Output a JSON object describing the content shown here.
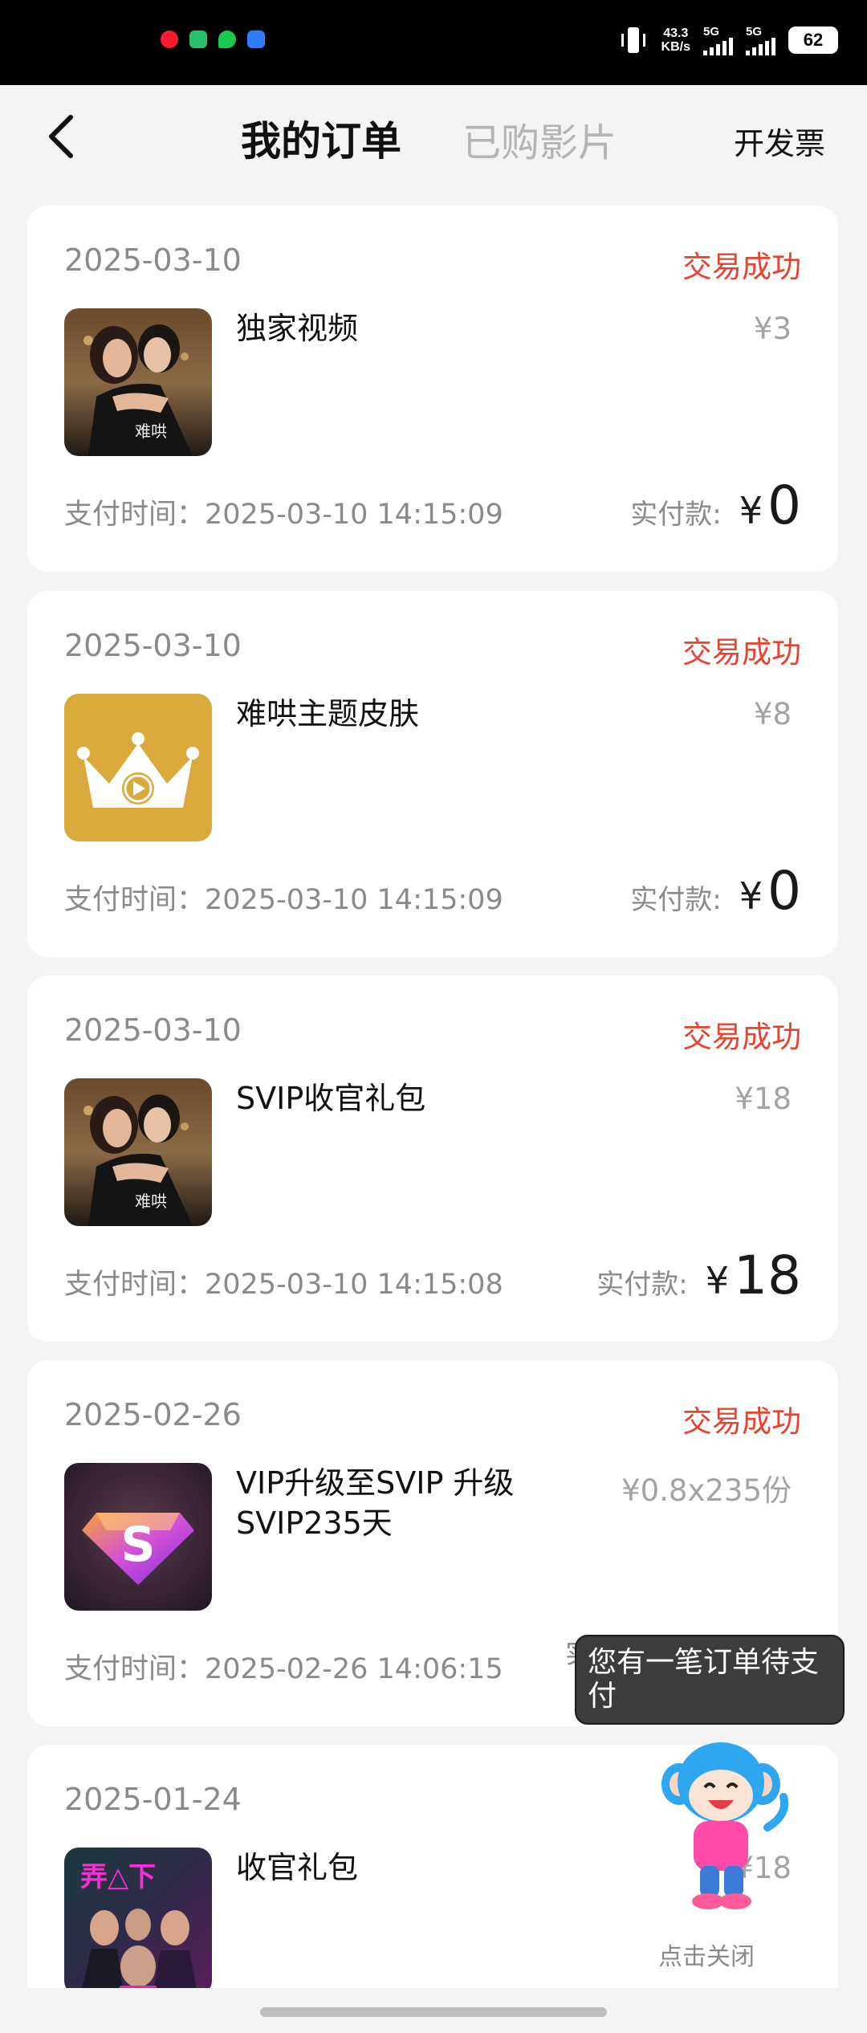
{
  "status_bar": {
    "net_speed_value": "43.3",
    "net_speed_unit": "KB/s",
    "sim1_label": "5G",
    "sim2_label": "5G",
    "battery": "62",
    "notification_colors": [
      "#ff1a2e",
      "#ff0a14",
      "#37c76b",
      "#18c94f",
      "#2e7cff"
    ]
  },
  "header": {
    "back_icon": "chevron-left-icon",
    "active_tab": "我的订单",
    "inactive_tab": "已购影片",
    "invoice_label": "开发票"
  },
  "orders": [
    {
      "date": "2025-03-10",
      "status": "交易成功",
      "name": "独家视频",
      "unit_price": "¥3",
      "pay_time": "支付时间：2025-03-10 14:15:09",
      "paid_label": "实付款:",
      "paid_currency": "¥",
      "paid_amount": "0",
      "thumb": "poster-couple"
    },
    {
      "date": "2025-03-10",
      "status": "交易成功",
      "name": "难哄主题皮肤",
      "unit_price": "¥8",
      "pay_time": "支付时间：2025-03-10 14:15:09",
      "paid_label": "实付款:",
      "paid_currency": "¥",
      "paid_amount": "0",
      "thumb": "crown-play-icon"
    },
    {
      "date": "2025-03-10",
      "status": "交易成功",
      "name": "SVIP收官礼包",
      "unit_price": "¥18",
      "pay_time": "支付时间：2025-03-10 14:15:08",
      "paid_label": "实付款:",
      "paid_currency": "¥",
      "paid_amount": "18",
      "thumb": "poster-couple"
    },
    {
      "date": "2025-02-26",
      "status": "交易成功",
      "name": "VIP升级至SVIP 升级SVIP235天",
      "unit_price": "¥0.8x235份",
      "pay_time": "支付时间：2025-02-26 14:06:15",
      "paid_label": "实付",
      "paid_currency": "",
      "paid_amount": "",
      "thumb": "svip-diamond-icon"
    },
    {
      "date": "2025-01-24",
      "status": "",
      "name": "收官礼包",
      "unit_price": "¥18",
      "pay_time": "",
      "paid_label": "",
      "paid_currency": "",
      "paid_amount": "",
      "thumb": "poster-cast"
    }
  ],
  "toast": {
    "text": "您有一笔订单待支付"
  },
  "mascot": {
    "close_label": "点击关闭",
    "icon": "monkey-mascot-icon"
  },
  "colors": {
    "accent": "#e8432f",
    "gold": "#d9a93b",
    "background": "#f4f4f4"
  }
}
